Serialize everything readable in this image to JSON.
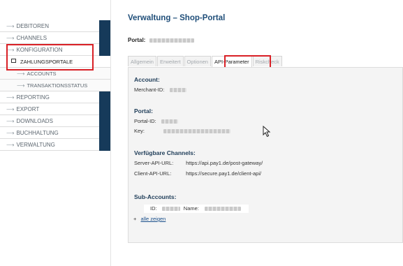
{
  "sidebar": {
    "items": [
      {
        "label": "DEBITOREN",
        "type": "main"
      },
      {
        "label": "CHANNELS",
        "type": "main"
      },
      {
        "label": "KONFIGURATION",
        "type": "main"
      },
      {
        "label": "ZAHLUNGSPORTALE",
        "type": "active"
      },
      {
        "label": "ACCOUNTS",
        "type": "sub"
      },
      {
        "label": "TRANSAKTIONSSTATUS",
        "type": "sub"
      },
      {
        "label": "REPORTING",
        "type": "main"
      },
      {
        "label": "EXPORT",
        "type": "main"
      },
      {
        "label": "DOWNLOADS",
        "type": "main"
      },
      {
        "label": "BUCHHALTUNG",
        "type": "main"
      },
      {
        "label": "VERWALTUNG",
        "type": "main"
      }
    ],
    "accent_color": "#163a5a",
    "highlight_color": "#d92026"
  },
  "main": {
    "title": "Verwaltung – Shop-Portal",
    "portal_label": "Portal:",
    "tabs": [
      {
        "label": "Allgemein",
        "active": false
      },
      {
        "label": "Erweitert",
        "active": false
      },
      {
        "label": "Optionen",
        "active": false
      },
      {
        "label": "API-Parameter",
        "active": true
      },
      {
        "label": "Riskcheck",
        "active": false
      }
    ],
    "account": {
      "heading": "Account:",
      "merchant_label": "Merchant-ID:"
    },
    "portal": {
      "heading": "Portal:",
      "portal_id_label": "Portal-ID:",
      "key_label": "Key:"
    },
    "channels": {
      "heading": "Verfügbare Channels:",
      "server_label": "Server-API-URL:",
      "server_url": "https://api.pay1.de/post-gateway/",
      "client_label": "Client-API-URL:",
      "client_url": "https://secure.pay1.de/client-api/"
    },
    "sub_accounts": {
      "heading": "Sub-Accounts:",
      "id_label": "ID:",
      "name_label": "Name:",
      "plus": "+",
      "show_all": "alle zeigen"
    }
  },
  "title_color": "#1f4e79"
}
